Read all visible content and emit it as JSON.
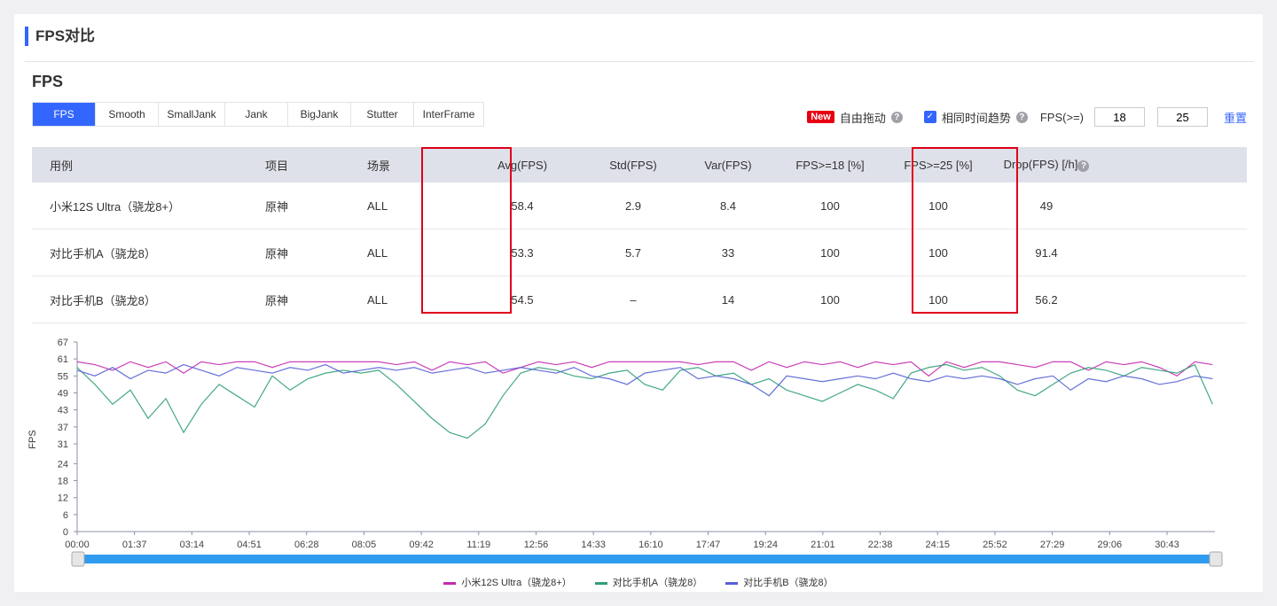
{
  "section_title": "FPS对比",
  "sub_title": "FPS",
  "tabs": [
    "FPS",
    "Smooth",
    "SmallJank",
    "Jank",
    "BigJank",
    "Stutter",
    "InterFrame"
  ],
  "active_tab": "FPS",
  "controls": {
    "new_badge": "New",
    "free_drag": "自由拖动",
    "same_time_trend": "相同时间趋势",
    "same_time_trend_checked": true,
    "fps_ge_label": "FPS(>=)",
    "fps_threshold_1": "18",
    "fps_threshold_2": "25",
    "reset": "重置"
  },
  "table": {
    "headers": [
      "用例",
      "项目",
      "场景",
      "Avg(FPS)",
      "Std(FPS)",
      "Var(FPS)",
      "FPS>=18 [%]",
      "FPS>=25 [%]",
      "Drop(FPS) [/h]"
    ],
    "rows": [
      [
        "小米12S Ultra（骁龙8+）",
        "原神",
        "ALL",
        "58.4",
        "2.9",
        "8.4",
        "100",
        "100",
        "49"
      ],
      [
        "对比手机A（骁龙8）",
        "原神",
        "ALL",
        "53.3",
        "5.7",
        "33",
        "100",
        "100",
        "91.4"
      ],
      [
        "对比手机B（骁龙8）",
        "原神",
        "ALL",
        "54.5",
        "–",
        "14",
        "100",
        "100",
        "56.2"
      ]
    ],
    "highlighted_columns": [
      "Avg(FPS)",
      "Drop(FPS) [/h]"
    ],
    "highlight_color": "#e0001b"
  },
  "chart_data": {
    "type": "line",
    "ylabel": "FPS",
    "yticks": [
      0,
      6,
      12,
      18,
      24,
      31,
      37,
      43,
      49,
      55,
      61,
      67
    ],
    "ylim": [
      0,
      67
    ],
    "xticks": [
      "00:00",
      "01:37",
      "03:14",
      "04:51",
      "06:28",
      "08:05",
      "09:42",
      "11:19",
      "12:56",
      "14:33",
      "16:10",
      "17:47",
      "19:24",
      "21:01",
      "22:38",
      "24:15",
      "25:52",
      "27:29",
      "29:06",
      "30:43"
    ],
    "x_interval_seconds": 30,
    "x_max_seconds": 1924,
    "legend_position": "bottom",
    "series": [
      {
        "name": "小米12S Ultra（骁龙8+）",
        "color": "#c42bb0",
        "values": [
          60,
          59,
          57,
          60,
          58,
          60,
          56,
          60,
          59,
          60,
          60,
          58,
          60,
          60,
          60,
          60,
          60,
          60,
          59,
          60,
          57,
          60,
          59,
          60,
          56,
          58,
          60,
          59,
          60,
          58,
          60,
          60,
          60,
          60,
          60,
          59,
          60,
          60,
          57,
          60,
          58,
          60,
          59,
          60,
          58,
          60,
          59,
          60,
          55,
          60,
          58,
          60,
          60,
          59,
          58,
          60,
          60,
          57,
          60,
          59,
          60,
          58,
          55,
          60,
          59
        ]
      },
      {
        "name": "对比手机A（骁龙8）",
        "color": "#2f9e78",
        "values": [
          58,
          52,
          45,
          50,
          40,
          47,
          35,
          45,
          52,
          48,
          44,
          55,
          50,
          54,
          56,
          57,
          56,
          57,
          52,
          46,
          40,
          35,
          33,
          38,
          48,
          56,
          58,
          57,
          55,
          54,
          56,
          57,
          52,
          50,
          57,
          58,
          55,
          56,
          52,
          54,
          50,
          48,
          46,
          49,
          52,
          50,
          47,
          56,
          58,
          59,
          57,
          58,
          55,
          50,
          48,
          52,
          56,
          58,
          57,
          55,
          58,
          57,
          56,
          59,
          45
        ]
      },
      {
        "name": "对比手机B（骁龙8）",
        "color": "#5560d6",
        "values": [
          57,
          55,
          58,
          54,
          57,
          56,
          59,
          57,
          55,
          58,
          57,
          56,
          58,
          57,
          59,
          56,
          57,
          58,
          57,
          58,
          56,
          57,
          58,
          56,
          57,
          58,
          57,
          56,
          58,
          55,
          54,
          52,
          56,
          57,
          58,
          54,
          55,
          54,
          52,
          48,
          55,
          54,
          53,
          54,
          55,
          54,
          56,
          54,
          53,
          55,
          54,
          55,
          54,
          52,
          54,
          55,
          50,
          54,
          53,
          55,
          54,
          52,
          53,
          55,
          54
        ]
      }
    ]
  }
}
